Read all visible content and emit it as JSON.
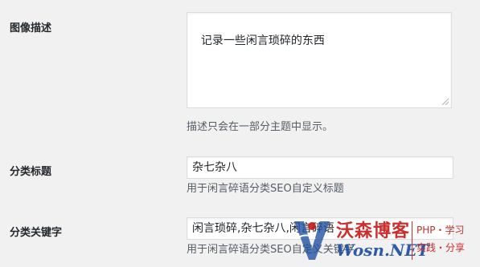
{
  "image_description": {
    "label": "图像描述",
    "value": "记录一些闲言琐碎的东西",
    "hint": "描述只会在一部分主题中显示。"
  },
  "category_title": {
    "label": "分类标题",
    "value": "杂七杂八",
    "hint": "用于闲言碎语分类SEO自定义标题"
  },
  "category_keywords": {
    "label": "分类关键字",
    "value": "闲言琐碎,杂七杂八,闲言碎语",
    "hint": "用于闲言碎语分类SEO自定义关键字"
  },
  "watermark": {
    "title": "沃森博客",
    "domain": "Wosn.NET",
    "tag1": "PHP・学习",
    "tag2": "实践・分享"
  }
}
